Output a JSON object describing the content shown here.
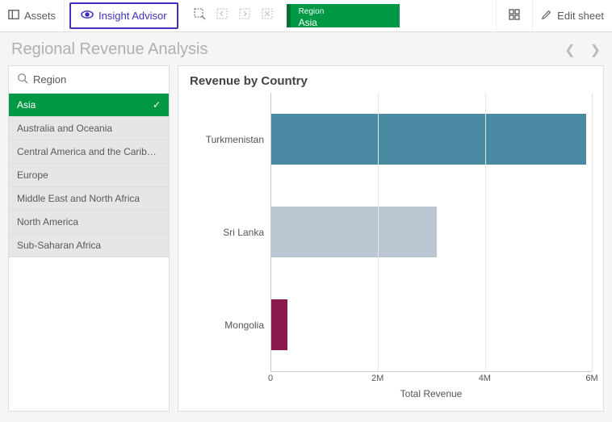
{
  "toolbar": {
    "assets_label": "Assets",
    "insight_label": "Insight Advisor",
    "selection_pill": {
      "label": "Region",
      "value": "Asia"
    },
    "edit_label": "Edit sheet"
  },
  "sheet": {
    "title": "Regional Revenue Analysis"
  },
  "filter": {
    "field_label": "Region",
    "items": [
      {
        "label": "Asia",
        "selected": true
      },
      {
        "label": "Australia and Oceania",
        "selected": false
      },
      {
        "label": "Central America and the Carib…",
        "selected": false
      },
      {
        "label": "Europe",
        "selected": false
      },
      {
        "label": "Middle East and North Africa",
        "selected": false
      },
      {
        "label": "North America",
        "selected": false
      },
      {
        "label": "Sub-Saharan Africa",
        "selected": false
      }
    ]
  },
  "chart": {
    "title": "Revenue by Country",
    "xlabel": "Total Revenue"
  },
  "chart_data": {
    "type": "bar",
    "orientation": "horizontal",
    "categories": [
      "Turkmenistan",
      "Sri Lanka",
      "Mongolia"
    ],
    "values": [
      5900000,
      3100000,
      300000
    ],
    "colors": [
      "#4a8ba3",
      "#bac6d2",
      "#8a1a4c"
    ],
    "title": "Revenue by Country",
    "xlabel": "Total Revenue",
    "ylabel": "",
    "xlim": [
      0,
      6000000
    ],
    "xticks": [
      0,
      2000000,
      4000000,
      6000000
    ],
    "xtick_labels": [
      "0",
      "2M",
      "4M",
      "6M"
    ]
  }
}
